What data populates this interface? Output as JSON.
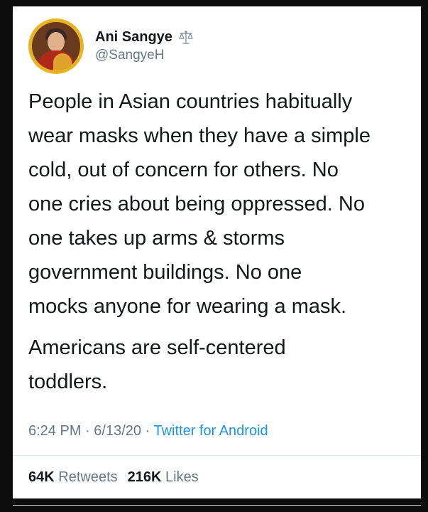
{
  "tweet": {
    "display_name": "Ani Sangye",
    "badge_icon": "scales-icon",
    "handle": "@SangyeH",
    "paragraphs": [
      "People in Asian countries habitually\nwear masks when they have a simple\ncold, out of concern for others. No\none cries about being oppressed. No\none takes up arms &  storms\ngovernment buildings. No one\nmocks anyone for wearing a mask.",
      "Americans are self-centered\ntoddlers."
    ],
    "time": "6:24 PM",
    "separator": "·",
    "date": "6/13/20",
    "source": "Twitter for Android",
    "retweets_count": "64K",
    "retweets_label": "Retweets",
    "likes_count": "216K",
    "likes_label": "Likes"
  },
  "colors": {
    "text": "#14171a",
    "secondary": "#657786",
    "link": "#1b95e0",
    "avatar_ring": "#e9b423"
  }
}
